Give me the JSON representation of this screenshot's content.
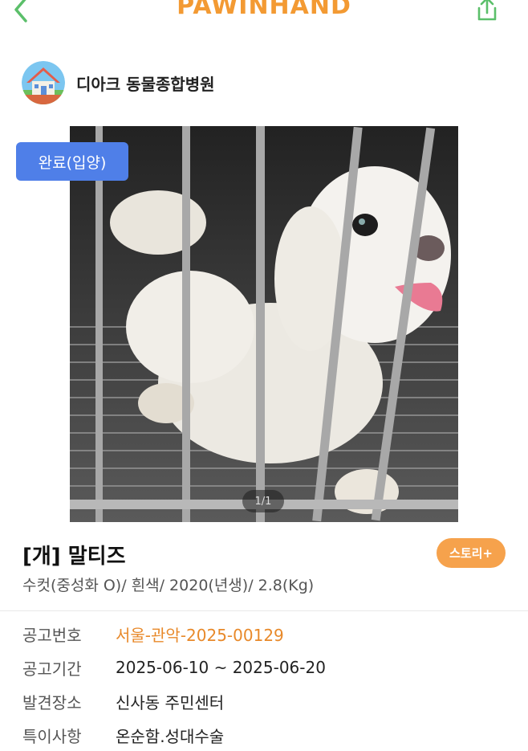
{
  "header": {
    "brand": "PAWINHAND",
    "back_icon": "chevron-left-icon",
    "share_icon": "share-icon"
  },
  "shelter": {
    "name": "디아크 동물종합병원",
    "avatar_icon": "house-icon"
  },
  "photo": {
    "status_badge": "완료(입양)",
    "counter": "1/1"
  },
  "animal": {
    "title": "[개] 말티즈",
    "subtitle": "수컷(중성화 O)/ 흰색/ 2020(년생)/ 2.8(Kg)",
    "story_button": "스토리+"
  },
  "details": [
    {
      "label": "공고번호",
      "value": "서울-관악-2025-00129"
    },
    {
      "label": "공고기간",
      "value": "2025-06-10 ~ 2025-06-20"
    },
    {
      "label": "발견장소",
      "value": "신사동 주민센터"
    },
    {
      "label": "특이사항",
      "value": "온순함.성대수술"
    }
  ],
  "colors": {
    "brand": "#f39a33",
    "back_icon": "#5bbf6a",
    "share_icon": "#5bbf6a",
    "status_badge": "#4f7fe8",
    "story_button": "#f6a24c",
    "notice_number": "#e8892a"
  }
}
